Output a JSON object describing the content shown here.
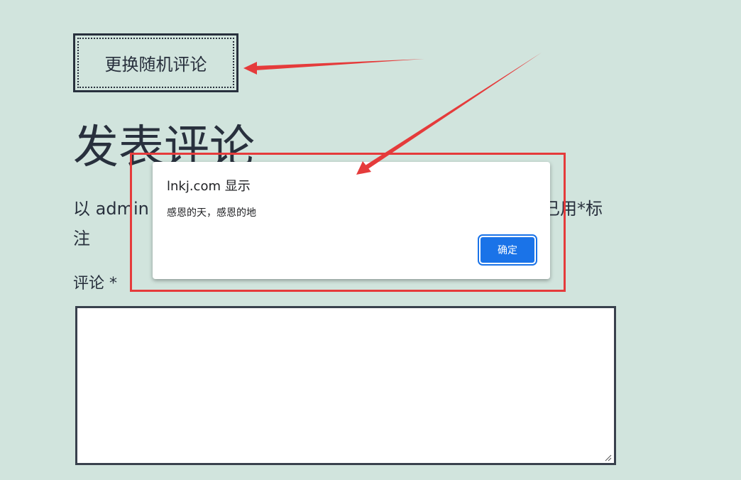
{
  "random_comment_button": {
    "label": "更换随机评论"
  },
  "reply": {
    "heading": "发表评论",
    "logged_in_prefix": "以 admin",
    "logged_in_suffix": "已用*标",
    "logged_in_line2": "注",
    "comment_label": "评论 *",
    "comment_value": ""
  },
  "alert": {
    "title": "lnkj.com 显示",
    "message": "感恩的天，感恩的地",
    "ok_label": "确定"
  },
  "colors": {
    "page_background": "#d1e4dd",
    "text": "#28303d",
    "annotation_red": "#e53b3b",
    "dialog_button": "#1a73e8"
  }
}
